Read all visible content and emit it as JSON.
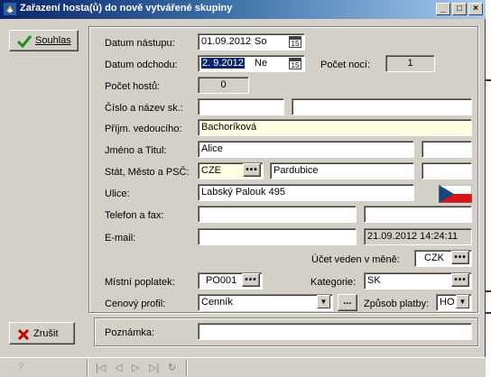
{
  "window": {
    "title": "Zařazení hosta(ů) do nově vytvářené skupiny",
    "min_glyph": "_",
    "max_glyph": "□",
    "close_glyph": "×"
  },
  "buttons": {
    "approve_label": "Souhlas",
    "cancel_label": "Zrušit",
    "dots": "•••",
    "ellipsis": "...",
    "cal_day": "15"
  },
  "form": {
    "arrival_label": "Datum nástupu:",
    "arrival_date": "01.09.2012",
    "arrival_day": "So",
    "departure_label": "Datum odchodu:",
    "departure_date": "2. 9.2012",
    "departure_day": "Ne",
    "nights_label": "Počet nocí:",
    "nights_value": "1",
    "guests_label": "Počet hostů:",
    "guests_value": "0",
    "group_label": "Číslo a název sk.:",
    "group_number": "",
    "group_name": "",
    "leader_label": "Příjm. vedoucího:",
    "leader_value": "Bachoríková",
    "name_label": "Jméno a Titul:",
    "first_name": "Alice",
    "title_value": "",
    "state_label": "Stát, Město a PSČ:",
    "state_value": "CZE",
    "city_value": "Pardubice",
    "zip_value": "",
    "street_label": "Ulice:",
    "street_value": "Labský Palouk 495",
    "phone_label": "Telefon a fax:",
    "phone_value": "",
    "fax_value": "",
    "email_label": "E-mail:",
    "email_value": "",
    "timestamp": "21.09.2012 14:24:11",
    "currency_label": "Účet veden v měně:",
    "currency_value": "CZK",
    "fee_label": "Místní poplatek:",
    "fee_value": "PO001",
    "category_label": "Kategorie:",
    "category_value": "SK",
    "pricelist_label": "Cenový profil:",
    "pricelist_value": "Cenník",
    "payment_label": "Způsob platby:",
    "payment_value": "HO",
    "note_label": "Poznámka:",
    "note_value": ""
  },
  "statusbar": {
    "help_glyph": "?",
    "nav": [
      "|◁",
      "◁",
      "▷",
      "▷|",
      "↻"
    ]
  },
  "colors": {
    "title_start": "#0a246a",
    "title_end": "#a6caf0",
    "highlight": "#ffffe1",
    "approve_check": "#1e8c1e",
    "cancel_x": "#c00000"
  }
}
